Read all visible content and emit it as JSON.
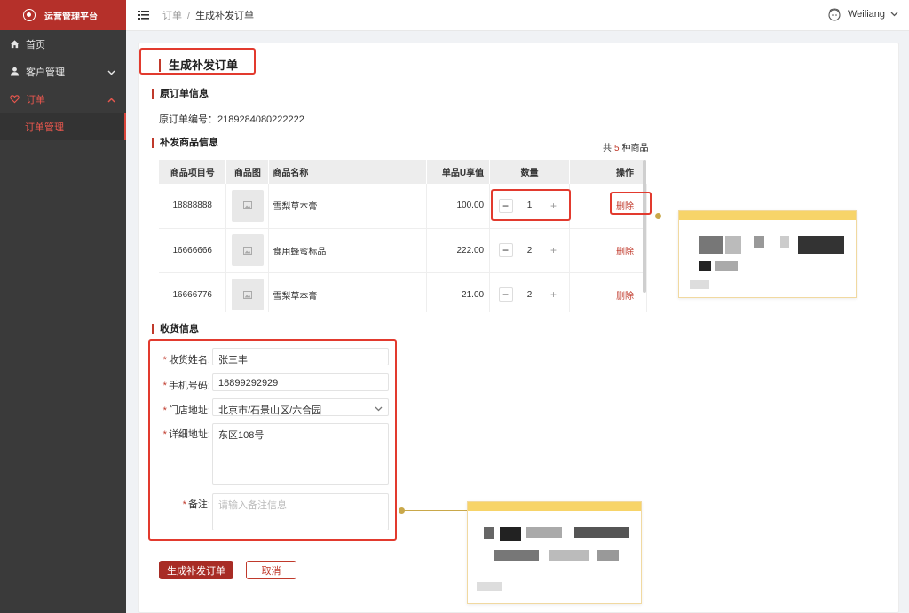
{
  "sidebar": {
    "brand": "运营管理平台",
    "items": [
      {
        "label": "首页",
        "icon": "home-icon"
      },
      {
        "label": "客户管理",
        "icon": "user-icon"
      },
      {
        "label": "订单",
        "icon": "heart-icon"
      }
    ],
    "sub_items": [
      {
        "label": "订单管理"
      }
    ]
  },
  "topbar": {
    "breadcrumb": [
      "订单",
      "生成补发订单"
    ],
    "username": "Weiliang"
  },
  "page": {
    "title": "生成补发订单"
  },
  "original_order": {
    "section_title": "原订单信息",
    "label": "原订单编号：",
    "number": "2189284080222222"
  },
  "products": {
    "section_title": "补发商品信息",
    "count_prefix": "共",
    "count": "5",
    "count_suffix": "种商品",
    "columns": [
      "商品项目号",
      "商品图",
      "商品名称",
      "单品U享值",
      "数量",
      "操作"
    ],
    "rows": [
      {
        "code": "18888888",
        "name": "雪梨草本膏",
        "price": "100.00",
        "qty": "1",
        "action": "删除"
      },
      {
        "code": "16666666",
        "name": "食用蜂蜜标品",
        "price": "222.00",
        "qty": "2",
        "action": "删除"
      },
      {
        "code": "16666776",
        "name": "雪梨草本膏",
        "price": "21.00",
        "qty": "2",
        "action": "删除"
      }
    ]
  },
  "shipping": {
    "section_title": "收货信息",
    "name_label": "收货姓名:",
    "name_value": "张三丰",
    "phone_label": "手机号码:",
    "phone_value": "18899292929",
    "store_label": "门店地址:",
    "store_value": "北京市/石景山区/六合园",
    "address_label": "详细地址:",
    "address_value": "东区108号",
    "remark_label": "备注:",
    "remark_placeholder": "请输入备注信息"
  },
  "actions": {
    "submit": "生成补发订单",
    "cancel": "取消"
  },
  "colors": {
    "brand": "#b5302a",
    "accent": "#c0392b",
    "highlight": "#e23a2e",
    "note_bar": "#f7d469"
  }
}
